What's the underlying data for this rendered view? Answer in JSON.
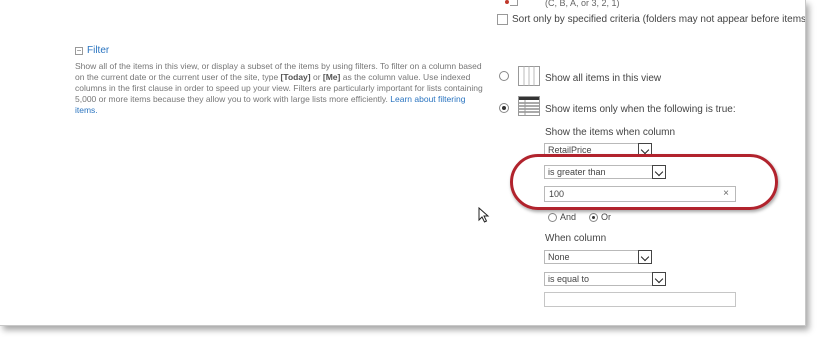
{
  "sort": {
    "hint_text": "(C, B, A, or 3, 2, 1)",
    "only_specified_label": "Sort only by specified criteria (folders may not appear before items)."
  },
  "filter": {
    "section_title": "Filter",
    "description_part1": "Show all of the items in this view, or display a subset of the items by using filters. To filter on a column based on the current date or the current user of the site, type ",
    "today_token": "[Today]",
    "description_or": " or ",
    "me_token": "[Me]",
    "description_part2": " as the column value. Use indexed columns in the first clause in order to speed up your view. Filters are particularly important for lists containing 5,000 or more items because they allow you to work with large lists more efficiently. ",
    "learn_more_link": "Learn about filtering items.",
    "option_all_label": "Show all items in this view",
    "option_filtered_label": "Show items only when the following is true:",
    "selected_option": "filtered",
    "column_label": "Show the items when column",
    "column_value": "RetailPrice",
    "operator_value": "is greater than",
    "value_input": "100",
    "clear_glyph": "×",
    "and_label": "And",
    "or_label": "Or",
    "logic_selected": "Or",
    "when_column_label": "When column",
    "second_column_value": "None",
    "second_operator_value": "is equal to",
    "second_value_input": ""
  },
  "icons": {
    "collapse": "minus-box-icon",
    "show_all": "blank-list-icon",
    "show_filtered": "filtered-list-icon",
    "dropdown": "chevron-down-icon",
    "cursor": "mouse-pointer-icon"
  },
  "colors": {
    "link": "#2a74c0",
    "highlight": "#b1232d"
  }
}
